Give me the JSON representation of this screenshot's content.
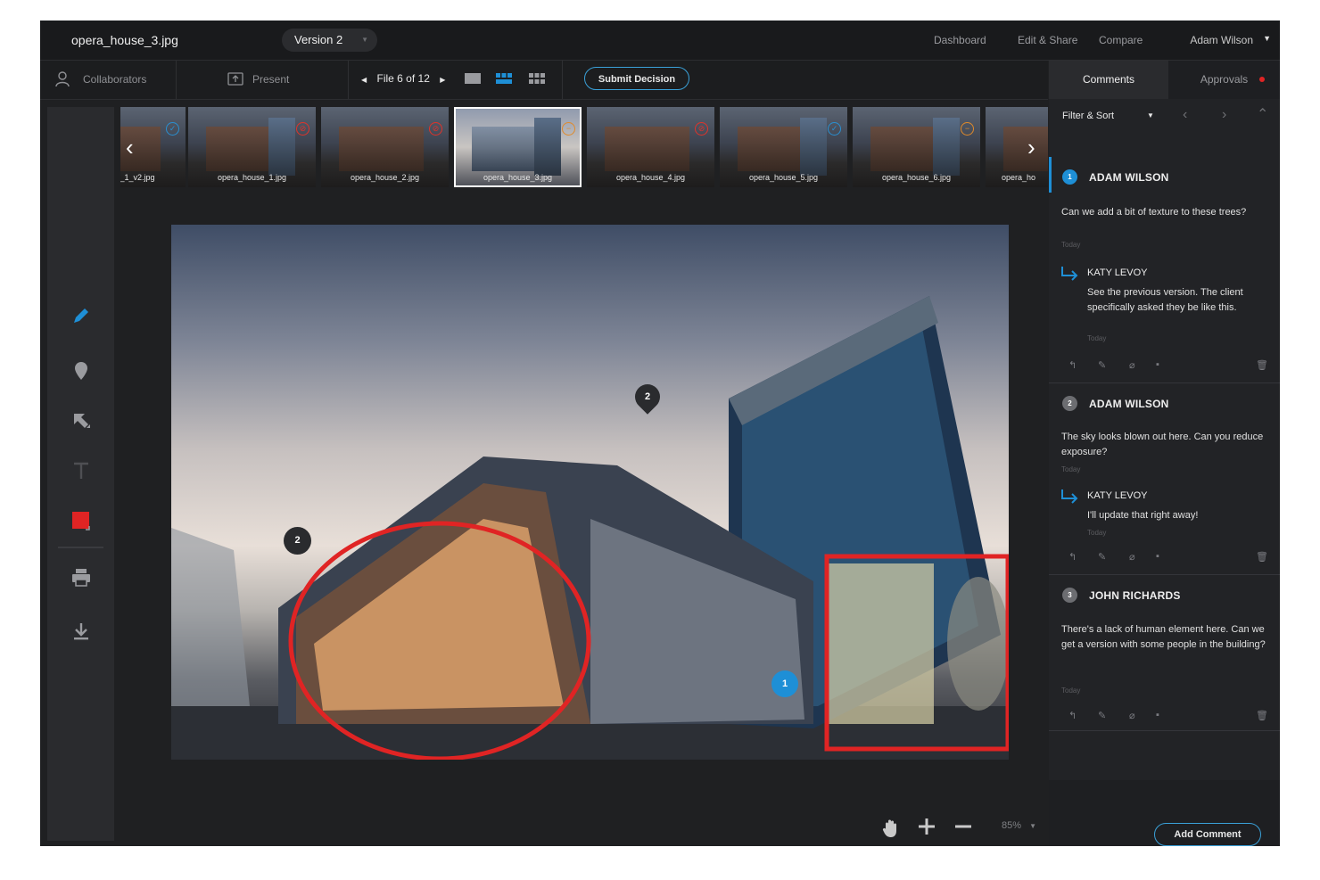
{
  "header": {
    "filename": "opera_house_3.jpg",
    "version": "Version 2",
    "nav": [
      "Dashboard",
      "Edit & Share",
      "Compare"
    ],
    "user": "Adam Wilson"
  },
  "toolbar": {
    "collaborators": "Collaborators",
    "present": "Present",
    "file_nav": "File 6 of 12",
    "submit": "Submit Decision"
  },
  "thumbnails": [
    {
      "label": "_1_v2.jpg",
      "status": "approved"
    },
    {
      "label": "opera_house_1.jpg",
      "status": "rejected"
    },
    {
      "label": "opera_house_2.jpg",
      "status": "rejected"
    },
    {
      "label": "opera_house_3.jpg",
      "status": "pending",
      "active": true
    },
    {
      "label": "opera_house_4.jpg",
      "status": "rejected"
    },
    {
      "label": "opera_house_5.jpg",
      "status": "approved"
    },
    {
      "label": "opera_house_6.jpg",
      "status": "pending"
    },
    {
      "label": "opera_ho",
      "status": "none"
    }
  ],
  "canvas": {
    "markers": [
      "2",
      "2",
      "1"
    ]
  },
  "zoom": {
    "level": "85%"
  },
  "panel": {
    "tab_comments": "Comments",
    "tab_approvals": "Approvals",
    "filter": "Filter & Sort",
    "threads": [
      {
        "num": "1",
        "author": "ADAM WILSON",
        "text": "Can we add a bit of texture to these trees?",
        "time": "Today",
        "reply": {
          "author": "KATY LEVOY",
          "text": "See the previous version. The client specifically asked they be like this.",
          "time": "Today"
        }
      },
      {
        "num": "2",
        "author": "ADAM WILSON",
        "text": "The sky looks blown out here. Can you reduce exposure?",
        "time": "Today",
        "reply": {
          "author": "KATY LEVOY",
          "text": "I'll update that right away!",
          "time": "Today"
        }
      },
      {
        "num": "3",
        "author": "JOHN RICHARDS",
        "text": "There's a lack of human element here. Can we get a version with some people in the building?",
        "time": "Today"
      }
    ],
    "add_comment": "Add Comment"
  },
  "colors": {
    "accent": "#1e8fd6",
    "annotation_red": "#e02424",
    "approved": "#2a8fd0",
    "rejected": "#e0332a",
    "pending": "#e08a2a"
  }
}
